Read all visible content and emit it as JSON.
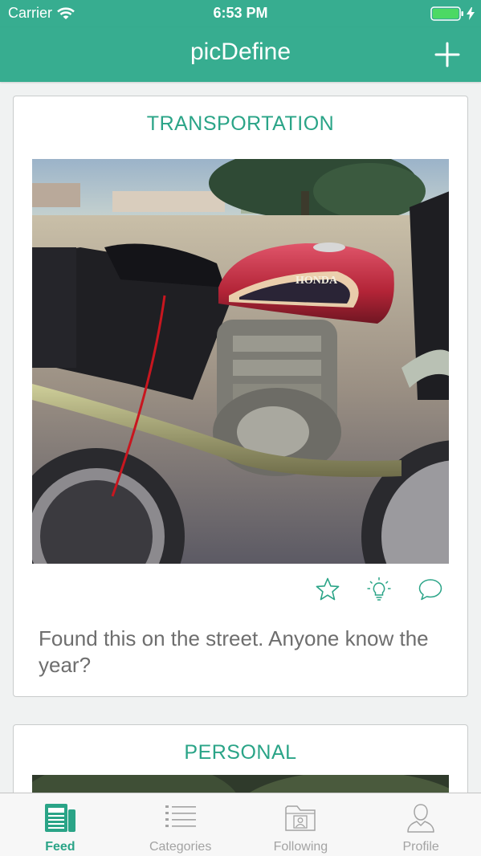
{
  "status_bar": {
    "carrier": "Carrier",
    "time": "6:53 PM"
  },
  "nav": {
    "title": "picDefine",
    "add_icon": "plus-icon"
  },
  "posts": [
    {
      "category": "TRANSPORTATION",
      "image_subject": "red Honda motorcycle parked on street",
      "image_text": "HONDA",
      "caption": "Found this on the street. Anyone know the year?",
      "actions": [
        "star-icon",
        "lightbulb-icon",
        "comment-icon"
      ]
    },
    {
      "category": "PERSONAL"
    }
  ],
  "tabs": [
    {
      "label": "Feed",
      "icon": "newspaper-icon",
      "active": true
    },
    {
      "label": "Categories",
      "icon": "list-icon",
      "active": false
    },
    {
      "label": "Following",
      "icon": "user-folder-icon",
      "active": false
    },
    {
      "label": "Profile",
      "icon": "person-icon",
      "active": false
    }
  ],
  "colors": {
    "accent": "#37ad90",
    "accent_text": "#2aa487",
    "battery": "#4cd964"
  }
}
